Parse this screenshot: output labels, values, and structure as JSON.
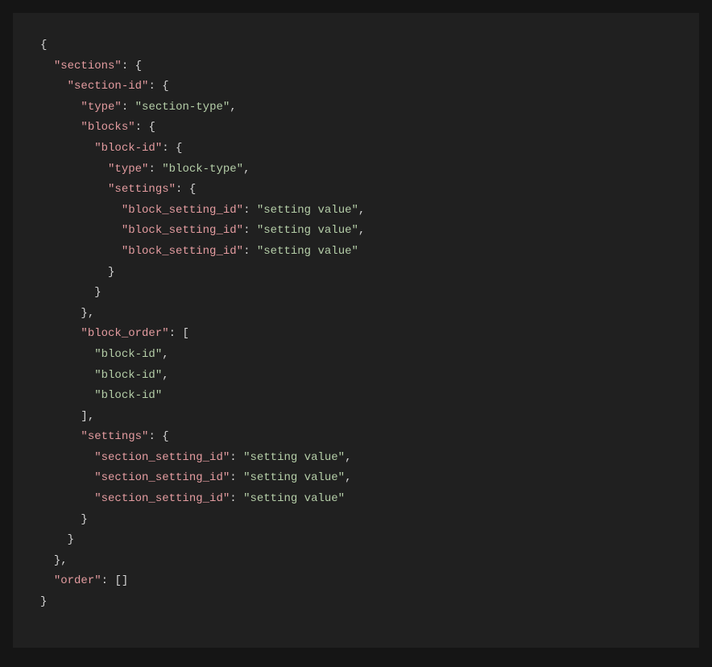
{
  "colors": {
    "background_outer": "#151515",
    "background_inner": "#202020",
    "punctuation": "#d4d4d4",
    "property": "#e49ca0",
    "string": "#b5cea8"
  },
  "code": {
    "tokens": [
      [
        [
          "punct",
          "{"
        ]
      ],
      [
        [
          "punct",
          "  "
        ],
        [
          "prop",
          "\"sections\""
        ],
        [
          "op",
          ": "
        ],
        [
          "punct",
          "{"
        ]
      ],
      [
        [
          "punct",
          "    "
        ],
        [
          "prop",
          "\"section-id\""
        ],
        [
          "op",
          ": "
        ],
        [
          "punct",
          "{"
        ]
      ],
      [
        [
          "punct",
          "      "
        ],
        [
          "prop",
          "\"type\""
        ],
        [
          "op",
          ": "
        ],
        [
          "str",
          "\"section-type\""
        ],
        [
          "punct",
          ","
        ]
      ],
      [
        [
          "punct",
          "      "
        ],
        [
          "prop",
          "\"blocks\""
        ],
        [
          "op",
          ": "
        ],
        [
          "punct",
          "{"
        ]
      ],
      [
        [
          "punct",
          "        "
        ],
        [
          "prop",
          "\"block-id\""
        ],
        [
          "op",
          ": "
        ],
        [
          "punct",
          "{"
        ]
      ],
      [
        [
          "punct",
          "          "
        ],
        [
          "prop",
          "\"type\""
        ],
        [
          "op",
          ": "
        ],
        [
          "str",
          "\"block-type\""
        ],
        [
          "punct",
          ","
        ]
      ],
      [
        [
          "punct",
          "          "
        ],
        [
          "prop",
          "\"settings\""
        ],
        [
          "op",
          ": "
        ],
        [
          "punct",
          "{"
        ]
      ],
      [
        [
          "punct",
          "            "
        ],
        [
          "prop",
          "\"block_setting_id\""
        ],
        [
          "op",
          ": "
        ],
        [
          "str",
          "\"setting value\""
        ],
        [
          "punct",
          ","
        ]
      ],
      [
        [
          "punct",
          "            "
        ],
        [
          "prop",
          "\"block_setting_id\""
        ],
        [
          "op",
          ": "
        ],
        [
          "str",
          "\"setting value\""
        ],
        [
          "punct",
          ","
        ]
      ],
      [
        [
          "punct",
          "            "
        ],
        [
          "prop",
          "\"block_setting_id\""
        ],
        [
          "op",
          ": "
        ],
        [
          "str",
          "\"setting value\""
        ]
      ],
      [
        [
          "punct",
          "          "
        ],
        [
          "punct",
          "}"
        ]
      ],
      [
        [
          "punct",
          "        "
        ],
        [
          "punct",
          "}"
        ]
      ],
      [
        [
          "punct",
          "      "
        ],
        [
          "punct",
          "},"
        ]
      ],
      [
        [
          "punct",
          "      "
        ],
        [
          "prop",
          "\"block_order\""
        ],
        [
          "op",
          ": "
        ],
        [
          "punct",
          "["
        ]
      ],
      [
        [
          "punct",
          "        "
        ],
        [
          "str",
          "\"block-id\""
        ],
        [
          "punct",
          ","
        ]
      ],
      [
        [
          "punct",
          "        "
        ],
        [
          "str",
          "\"block-id\""
        ],
        [
          "punct",
          ","
        ]
      ],
      [
        [
          "punct",
          "        "
        ],
        [
          "str",
          "\"block-id\""
        ]
      ],
      [
        [
          "punct",
          "      "
        ],
        [
          "punct",
          "],"
        ]
      ],
      [
        [
          "punct",
          "      "
        ],
        [
          "prop",
          "\"settings\""
        ],
        [
          "op",
          ": "
        ],
        [
          "punct",
          "{"
        ]
      ],
      [
        [
          "punct",
          "        "
        ],
        [
          "prop",
          "\"section_setting_id\""
        ],
        [
          "op",
          ": "
        ],
        [
          "str",
          "\"setting value\""
        ],
        [
          "punct",
          ","
        ]
      ],
      [
        [
          "punct",
          "        "
        ],
        [
          "prop",
          "\"section_setting_id\""
        ],
        [
          "op",
          ": "
        ],
        [
          "str",
          "\"setting value\""
        ],
        [
          "punct",
          ","
        ]
      ],
      [
        [
          "punct",
          "        "
        ],
        [
          "prop",
          "\"section_setting_id\""
        ],
        [
          "op",
          ": "
        ],
        [
          "str",
          "\"setting value\""
        ]
      ],
      [
        [
          "punct",
          "      "
        ],
        [
          "punct",
          "}"
        ]
      ],
      [
        [
          "punct",
          "    "
        ],
        [
          "punct",
          "}"
        ]
      ],
      [
        [
          "punct",
          "  "
        ],
        [
          "punct",
          "},"
        ]
      ],
      [
        [
          "punct",
          "  "
        ],
        [
          "prop",
          "\"order\""
        ],
        [
          "op",
          ": "
        ],
        [
          "punct",
          "[]"
        ]
      ],
      [
        [
          "punct",
          "}"
        ]
      ]
    ]
  }
}
